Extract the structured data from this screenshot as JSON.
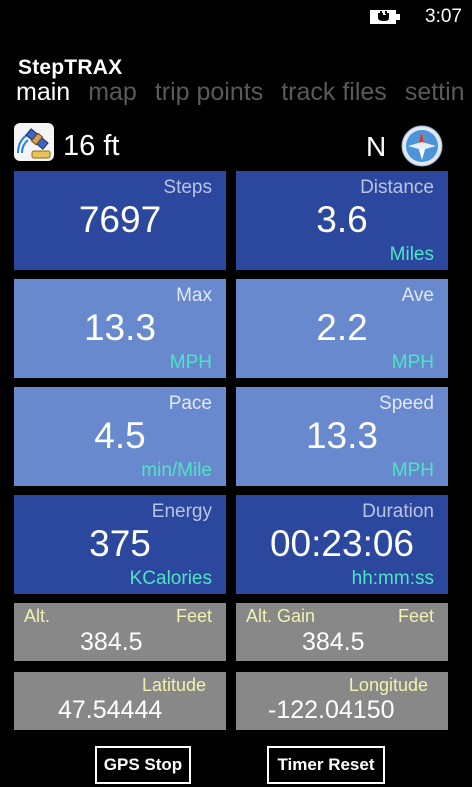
{
  "status": {
    "time": "3:07"
  },
  "app": {
    "title": "StepTRAX"
  },
  "pivot": {
    "items": [
      "main",
      "map",
      "trip points",
      "track files",
      "settin"
    ]
  },
  "header": {
    "accuracy": "16 ft",
    "heading": "N"
  },
  "tiles": {
    "steps": {
      "label": "Steps",
      "value": "7697",
      "unit": ""
    },
    "distance": {
      "label": "Distance",
      "value": "3.6",
      "unit": "Miles"
    },
    "max": {
      "label": "Max",
      "value": "13.3",
      "unit": "MPH"
    },
    "ave": {
      "label": "Ave",
      "value": "2.2",
      "unit": "MPH"
    },
    "pace": {
      "label": "Pace",
      "value": "4.5",
      "unit": "min/Mile"
    },
    "speed": {
      "label": "Speed",
      "value": "13.3",
      "unit": "MPH"
    },
    "energy": {
      "label": "Energy",
      "value": "375",
      "unit": "KCalories"
    },
    "duration": {
      "label": "Duration",
      "value": "00:23:06",
      "unit": "hh:mm:ss"
    }
  },
  "grey": {
    "alt": {
      "label": "Alt.",
      "unit": "Feet",
      "value": "384.5"
    },
    "alt_gain": {
      "label": "Alt. Gain",
      "unit": "Feet",
      "value": "384.5"
    },
    "latitude": {
      "label": "Latitude",
      "value": "47.54444"
    },
    "longitude": {
      "label": "Longitude",
      "value": "-122.04150"
    }
  },
  "buttons": {
    "gps_stop": "GPS Stop",
    "timer_reset": "Timer Reset"
  },
  "colors": {
    "tile_dark": "#2c489e",
    "tile_light": "#6889ce",
    "unit_accent": "#4fe3c5",
    "grey_tile": "#888888",
    "grey_label": "#f2f2b0"
  },
  "icons": {
    "gps": "gps-satellite-icon",
    "compass": "compass-icon",
    "battery": "battery-charging-icon"
  }
}
